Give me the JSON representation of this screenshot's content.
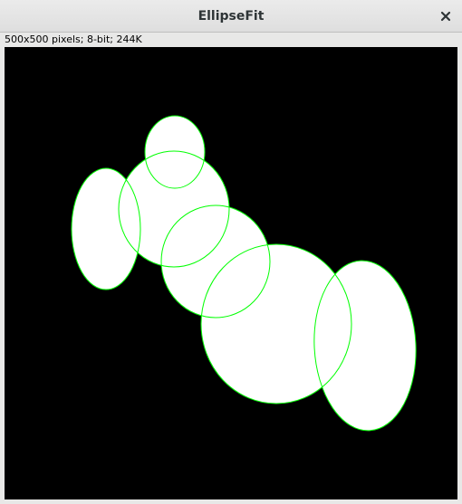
{
  "window": {
    "title": "EllipseFit"
  },
  "status": {
    "text": "500x500 pixels; 8-bit; 244K"
  },
  "colors": {
    "background": "#000000",
    "blob_fill": "#ffffff",
    "fit_outline": "#00ff00"
  },
  "icons": {
    "close": "close-icon"
  }
}
